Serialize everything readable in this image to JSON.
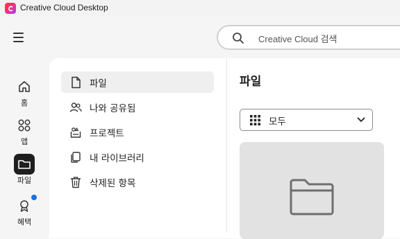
{
  "window": {
    "title": "Creative Cloud Desktop"
  },
  "header": {
    "search_placeholder": "Creative Cloud 검색"
  },
  "rail": {
    "items": [
      {
        "label": "홈",
        "icon": "home-icon"
      },
      {
        "label": "앱",
        "icon": "apps-icon"
      },
      {
        "label": "파일",
        "icon": "folder-icon",
        "active": true
      },
      {
        "label": "혜택",
        "icon": "rewards-icon",
        "notification": true
      }
    ]
  },
  "files_nav": {
    "items": [
      {
        "label": "파일",
        "icon": "document-icon",
        "active": true
      },
      {
        "label": "나와 공유됨",
        "icon": "shared-users-icon"
      },
      {
        "label": "프로젝트",
        "icon": "project-icon"
      },
      {
        "label": "내 라이브러리",
        "icon": "library-icon"
      },
      {
        "label": "삭제된 항목",
        "icon": "trash-icon"
      }
    ]
  },
  "content": {
    "title": "파일",
    "filter": {
      "selected": "모두"
    },
    "card": {
      "icon": "folder-icon"
    }
  },
  "colors": {
    "accent": "#1473e6",
    "active_rail": "#1f1f1f",
    "logo_start": "#ff3b30",
    "logo_end": "#a23bff"
  }
}
